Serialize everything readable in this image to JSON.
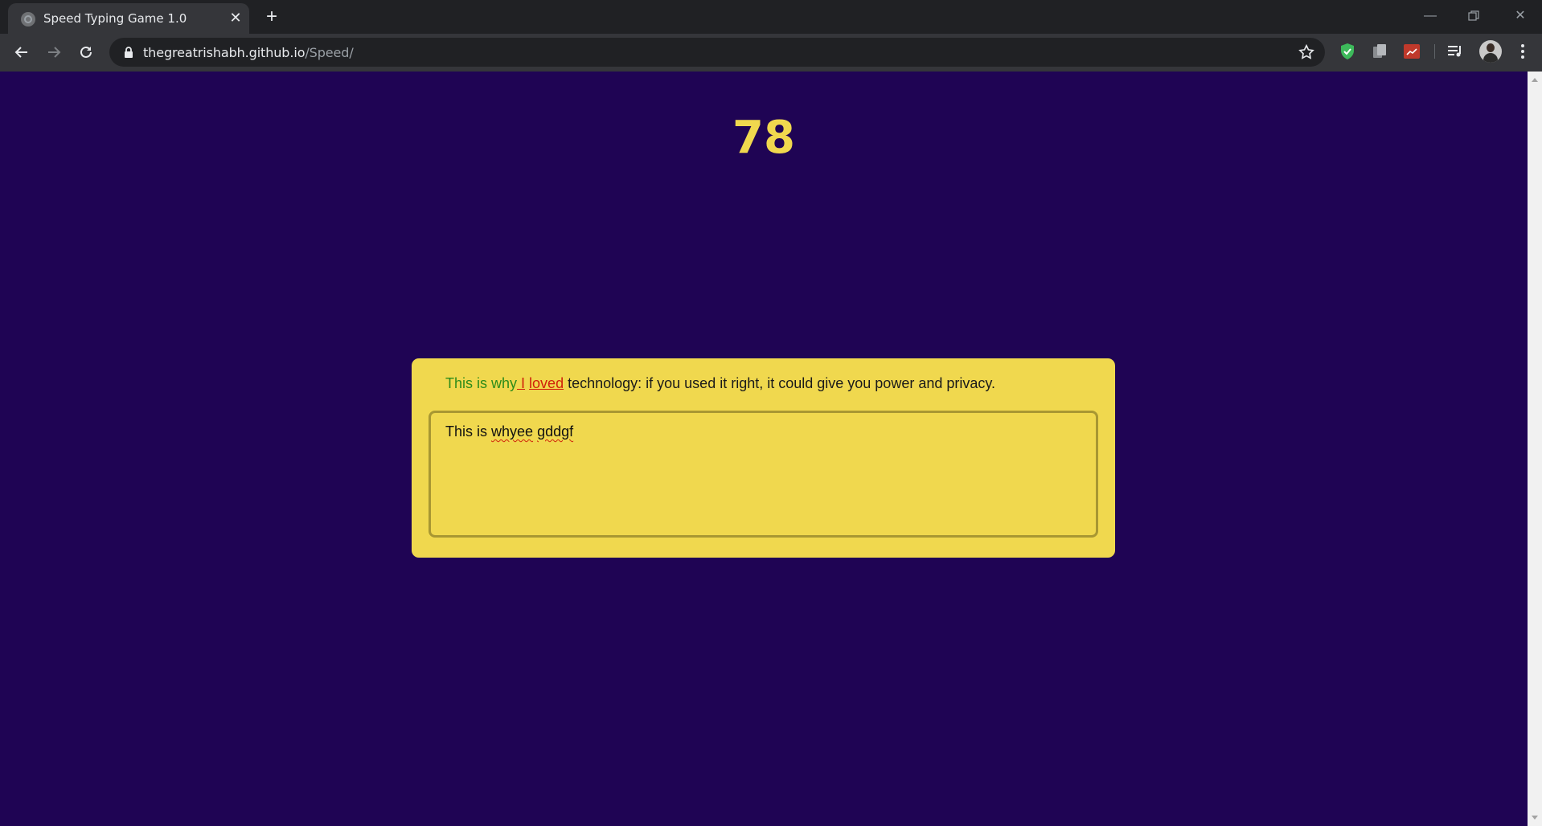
{
  "browser": {
    "tab_title": "Speed Typing Game 1.0",
    "url_host": "thegreatrishabh.github.io",
    "url_path": "/Speed/"
  },
  "game": {
    "timer": "78",
    "quote_correct": "This is why",
    "quote_incorrect_1": " I",
    "quote_space": " ",
    "quote_incorrect_2": "loved",
    "quote_rest": " technology: if you used it right, it could give you power and privacy.",
    "input_prefix": "This is ",
    "input_word_1": "whyee",
    "input_space": " ",
    "input_word_2": "gddgf"
  },
  "colors": {
    "background": "#1f0454",
    "card": "#f0d84e",
    "timer": "#f0d84e",
    "correct": "#2d8c1a",
    "incorrect": "#d0210a"
  },
  "icons": {
    "tab": "globe-icon",
    "back": "back-arrow-icon",
    "forward": "forward-arrow-icon",
    "reload": "reload-icon",
    "lock": "lock-icon",
    "bookmark": "star-icon",
    "extensions": [
      "shield-check-icon",
      "copy-icon",
      "pdf-icon",
      "media-queue-icon"
    ],
    "menu": "kebab-menu-icon"
  }
}
